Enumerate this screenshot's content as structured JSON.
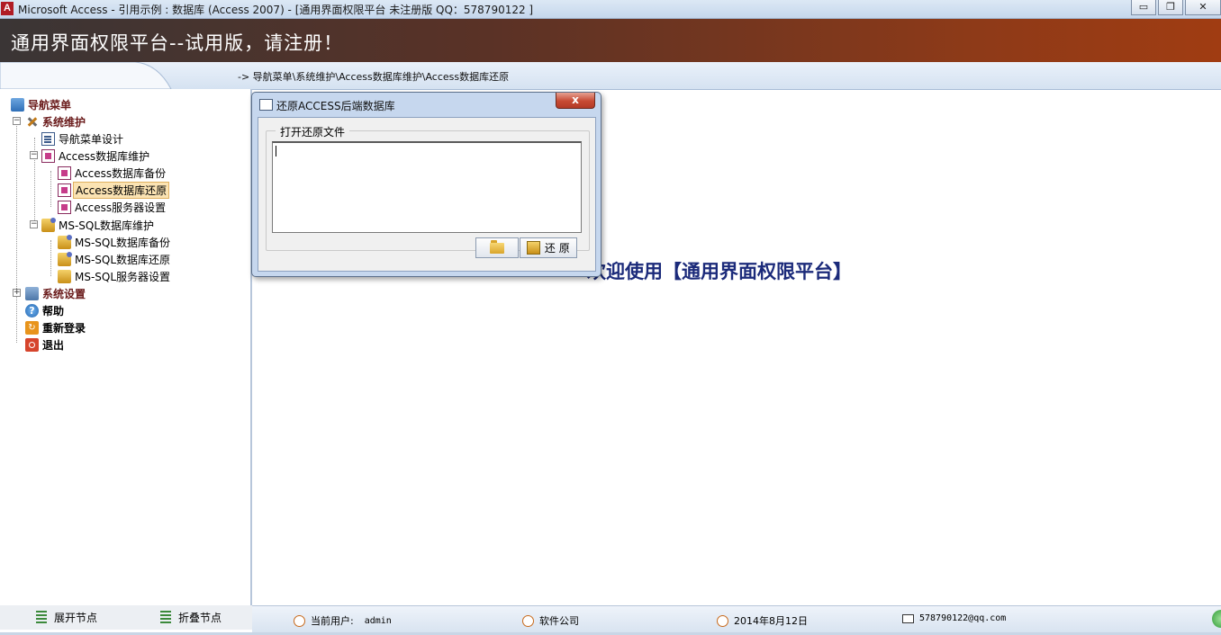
{
  "window": {
    "title": "Microsoft Access - 引用示例 : 数据库 (Access 2007) - [通用界面权限平台  未注册版 QQ：578790122 ]",
    "app_icon": "A",
    "minimize": "▭",
    "restore": "❐",
    "close": "✕"
  },
  "banner": {
    "text": "通用界面权限平台--试用版，请注册！"
  },
  "breadcrumb": {
    "text": "-> 导航菜单\\系统维护\\Access数据库维护\\Access数据库还原"
  },
  "nav": {
    "root": "导航菜单",
    "system_maintenance": "系统维护",
    "menu_design": "导航菜单设计",
    "access_maintenance": "Access数据库维护",
    "access_backup": "Access数据库备份",
    "access_restore": "Access数据库还原",
    "access_server": "Access服务器设置",
    "mssql_maintenance": "MS-SQL数据库维护",
    "mssql_backup": "MS-SQL数据库备份",
    "mssql_restore": "MS-SQL数据库还原",
    "mssql_server": "MS-SQL服务器设置",
    "system_settings": "系统设置",
    "help": "帮助",
    "relogin": "重新登录",
    "exit": "退出",
    "expand_label": "展开节点",
    "collapse_label": "折叠节点"
  },
  "main": {
    "welcome": "欢迎使用【通用界面权限平台】"
  },
  "dialog": {
    "title": "还原ACCESS后端数据库",
    "group_label": "打开还原文件",
    "file_value": "",
    "restore_label": "还 原",
    "close_label": "x"
  },
  "status": {
    "user_label": "当前用户:",
    "user_value": "admin",
    "company": "软件公司",
    "date": "2014年8月12日",
    "email": "578790122@qq.com"
  },
  "colors": {
    "banner_start": "#3a3535",
    "banner_end": "#a03c12",
    "welcome": "#1b2a7a"
  }
}
